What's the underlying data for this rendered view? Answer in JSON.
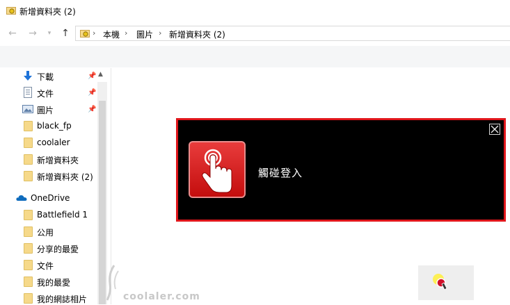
{
  "window": {
    "title": "新增資料夾 (2)"
  },
  "breadcrumb": [
    "本機",
    "圖片",
    "新增資料夾 (2)"
  ],
  "quick_access": [
    {
      "label": "下載",
      "icon": "download-icon",
      "pinned": true
    },
    {
      "label": "文件",
      "icon": "document-icon",
      "pinned": true
    },
    {
      "label": "圖片",
      "icon": "pictures-icon",
      "pinned": true
    },
    {
      "label": "black_fp",
      "icon": "folder-icon"
    },
    {
      "label": "coolaler",
      "icon": "folder-icon"
    },
    {
      "label": "新增資料夾",
      "icon": "folder-icon"
    },
    {
      "label": "新增資料夾 (2)",
      "icon": "folder-icon"
    }
  ],
  "onedrive": {
    "label": "OneDrive",
    "items": [
      "Battlefield 1",
      "公用",
      "分享的最愛",
      "文件",
      "我的最愛",
      "我的網誌相片"
    ]
  },
  "overlay": {
    "message": "觸碰登入"
  },
  "watermark": {
    "text": "coolaler.com"
  },
  "colors": {
    "overlay_border": "#e0161b",
    "touch_button": "#d41c1c",
    "folder": "#f6d98a",
    "onedrive": "#0f6cbd"
  }
}
